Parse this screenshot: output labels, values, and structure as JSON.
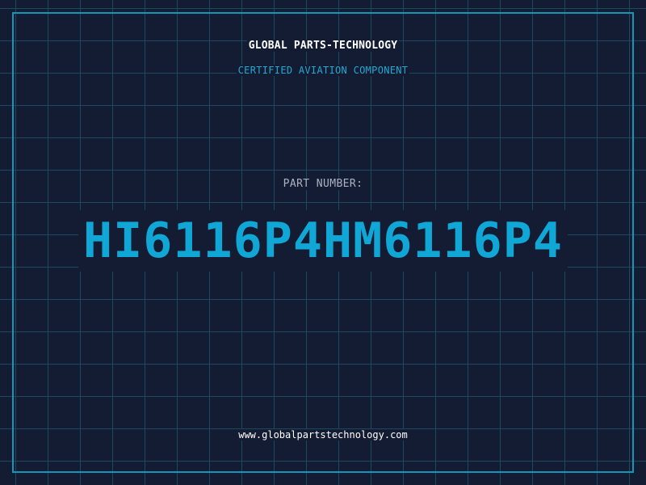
{
  "header": {
    "company_name": "GLOBAL PARTS-TECHNOLOGY",
    "tagline": "CERTIFIED AVIATION COMPONENT"
  },
  "part": {
    "label": "PART NUMBER:",
    "number": "HI6116P4HM6116P4"
  },
  "footer": {
    "website": "www.globalpartstechnology.com"
  },
  "colors": {
    "background": "#131c33",
    "grid": "#1a4a5e",
    "frame": "#1496b8",
    "accent": "#10a7d6",
    "tagline": "#21a9d3",
    "label": "#a9b4c2",
    "text": "#ffffff"
  }
}
